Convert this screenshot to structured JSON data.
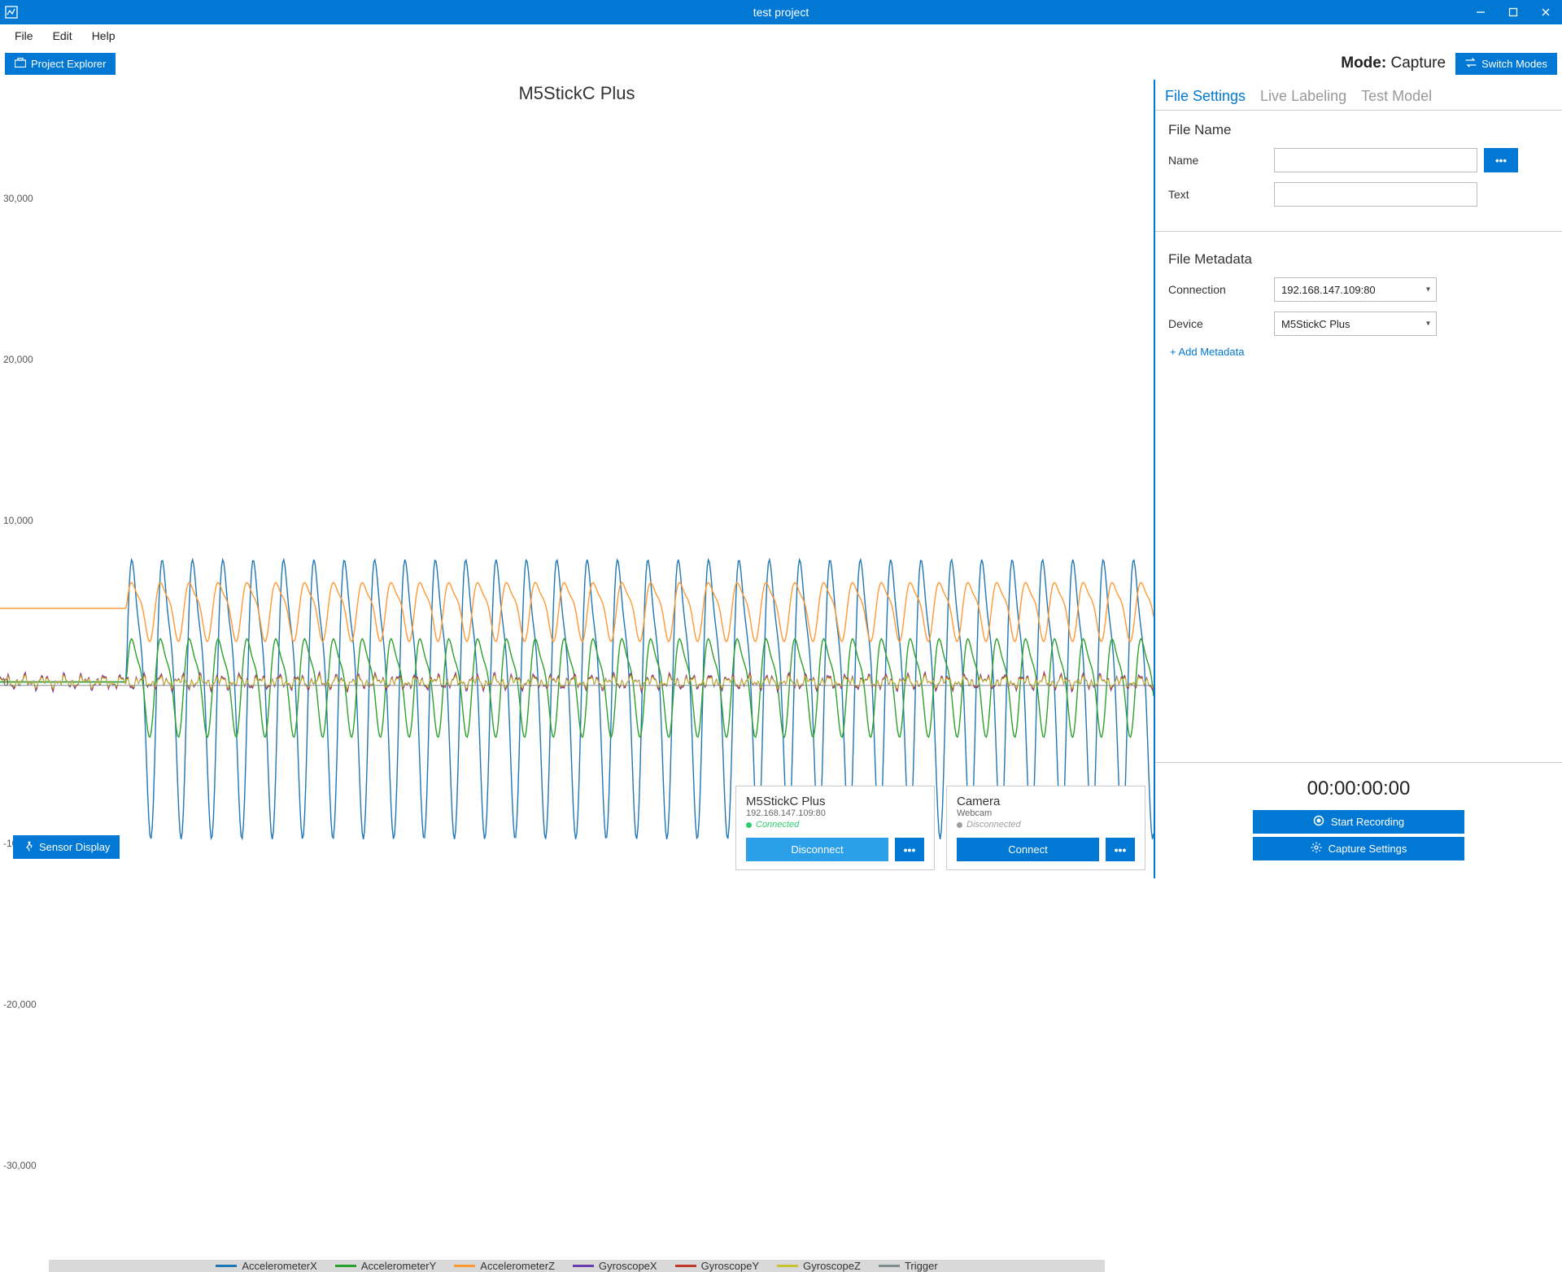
{
  "window": {
    "title": "test project"
  },
  "menu": {
    "file": "File",
    "edit": "Edit",
    "help": "Help"
  },
  "toolbar": {
    "project_explorer": "Project Explorer",
    "mode_prefix": "Mode: ",
    "mode_value": "Capture",
    "switch_modes": "Switch Modes"
  },
  "chart_data": {
    "type": "line",
    "title": "M5StickC Plus",
    "xlabel": "",
    "ylabel": "",
    "ylim": [
      -33000,
      33000
    ],
    "yticks": [
      -30000,
      -20000,
      -10000,
      0,
      10000,
      20000,
      30000
    ],
    "ytick_labels": [
      "-30,000",
      "-20,000",
      "-10,000",
      "0",
      "10,000",
      "20,000",
      "30,000"
    ],
    "x_range": [
      0,
      1000
    ],
    "series": [
      {
        "name": "AccelerometerX",
        "color": "#1f77b4",
        "pattern": "oscillating",
        "amplitude": 8500,
        "baseline": 0,
        "frequency": 38,
        "start": 110
      },
      {
        "name": "AccelerometerY",
        "color": "#2ca02c",
        "pattern": "oscillating",
        "amplitude": 3000,
        "baseline": 0,
        "frequency": 40,
        "start": 110
      },
      {
        "name": "AccelerometerZ",
        "color": "#ff9933",
        "pattern": "oscillating",
        "amplitude": 1800,
        "baseline": 4200,
        "frequency": 40,
        "start": 110,
        "pre_start_value": 4200
      },
      {
        "name": "GyroscopeX",
        "color": "#6a3fae",
        "pattern": "noise",
        "amplitude": 600,
        "baseline": 0,
        "frequency": 80,
        "start": 0
      },
      {
        "name": "GyroscopeY",
        "color": "#c0392b",
        "pattern": "noise",
        "amplitude": 500,
        "baseline": 0,
        "frequency": 90,
        "start": 0
      },
      {
        "name": "GyroscopeZ",
        "color": "#c5c533",
        "pattern": "noise",
        "amplitude": 400,
        "baseline": 0,
        "frequency": 85,
        "start": 0
      },
      {
        "name": "Trigger",
        "color": "#7f8c8d",
        "pattern": "flat",
        "amplitude": 0,
        "baseline": -200,
        "frequency": 0,
        "start": 0
      }
    ]
  },
  "legend": [
    {
      "label": "AccelerometerX",
      "color": "#1f77b4"
    },
    {
      "label": "AccelerometerY",
      "color": "#2ca02c"
    },
    {
      "label": "AccelerometerZ",
      "color": "#ff9933"
    },
    {
      "label": "GyroscopeX",
      "color": "#6a3fae"
    },
    {
      "label": "GyroscopeY",
      "color": "#c0392b"
    },
    {
      "label": "GyroscopeZ",
      "color": "#c5c533"
    },
    {
      "label": "Trigger",
      "color": "#7f8c8d"
    }
  ],
  "sensor_display_btn": "Sensor Display",
  "device_card": {
    "title": "M5StickC Plus",
    "subtitle": "192.168.147.109:80",
    "status_text": "Connected",
    "status_color": "#2ecc71",
    "action": "Disconnect",
    "menu": "•••"
  },
  "camera_card": {
    "title": "Camera",
    "subtitle": "Webcam",
    "status_text": "Disconnected",
    "status_color": "#9e9e9e",
    "action": "Connect",
    "menu": "•••"
  },
  "right_panel": {
    "tabs": {
      "file_settings": "File Settings",
      "live_labeling": "Live Labeling",
      "test_model": "Test Model"
    },
    "section_file_name": "File Name",
    "name_label": "Name",
    "name_value": "",
    "name_more": "•••",
    "text_label": "Text",
    "text_value": "",
    "section_metadata": "File Metadata",
    "connection_label": "Connection",
    "connection_value": "192.168.147.109:80",
    "device_label": "Device",
    "device_value": "M5StickC Plus",
    "add_metadata": "+ Add Metadata",
    "timer": "00:00:00:00",
    "start_recording": "Start Recording",
    "capture_settings": "Capture Settings"
  }
}
